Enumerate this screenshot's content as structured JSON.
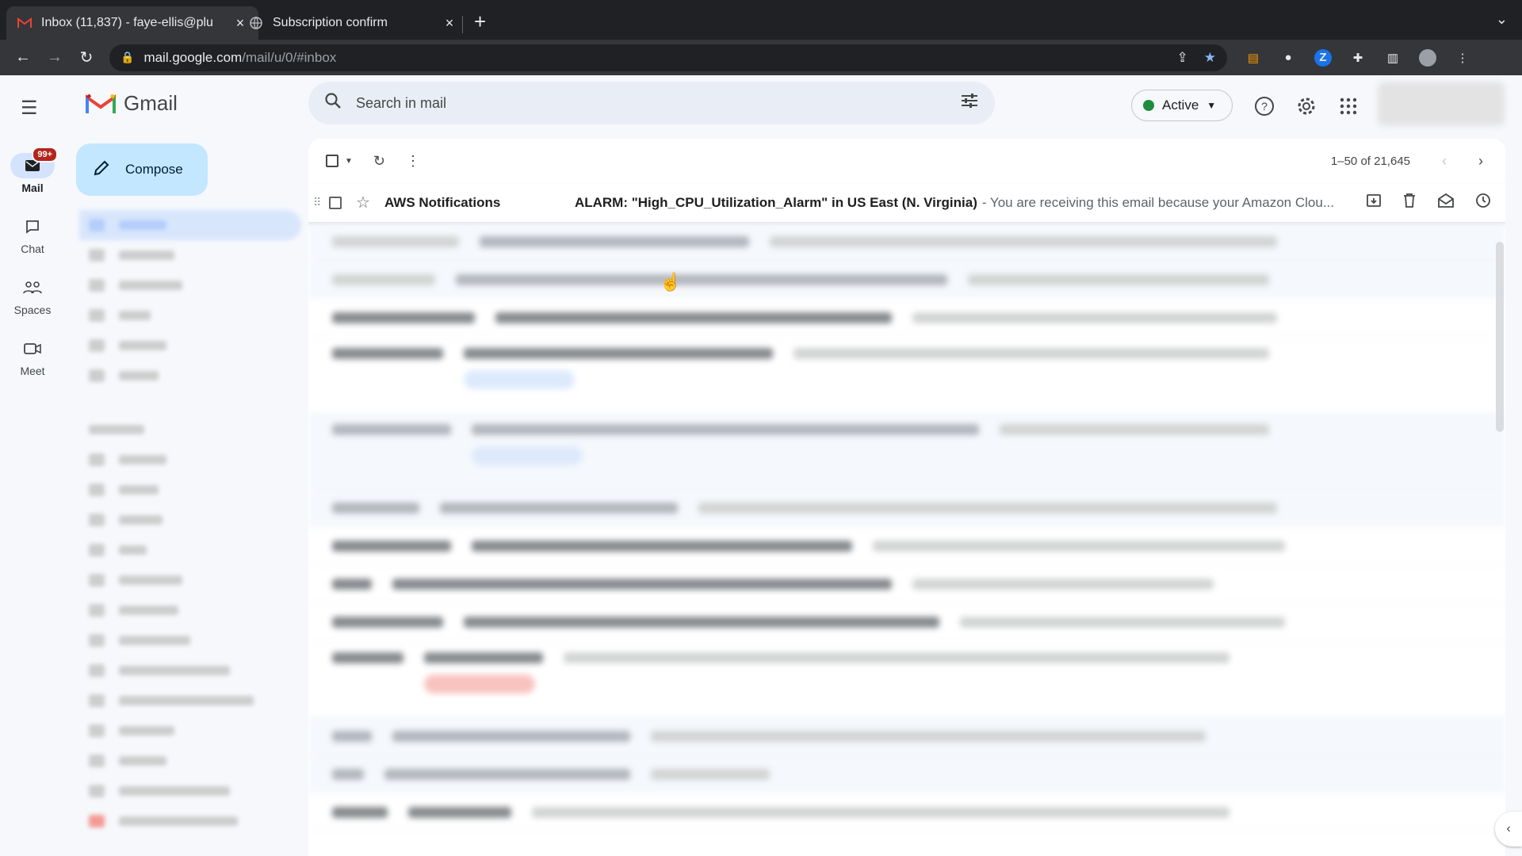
{
  "browser": {
    "tabs": [
      {
        "title": "Inbox (11,837) - faye-ellis@plu",
        "active": true
      },
      {
        "title": "Subscription confirm",
        "active": false
      }
    ],
    "url_host": "mail.google.com",
    "url_path": "/mail/u/0/#inbox"
  },
  "gmail": {
    "app_name": "Gmail",
    "compose_label": "Compose",
    "search_placeholder": "Search in mail",
    "status_label": "Active",
    "rail": [
      {
        "label": "Mail",
        "badge": "99+"
      },
      {
        "label": "Chat"
      },
      {
        "label": "Spaces"
      },
      {
        "label": "Meet"
      }
    ],
    "pagination": "1–50 of 21,645",
    "focused_email": {
      "sender": "AWS Notifications",
      "subject": "ALARM: \"High_CPU_Utilization_Alarm\" in US East (N. Virginia)",
      "snippet": " - You are receiving this email because your Amazon Clou..."
    }
  },
  "colors": {
    "accent": "#c2e7ff",
    "active_status": "#1e8e3e",
    "badge": "#b3261e"
  }
}
